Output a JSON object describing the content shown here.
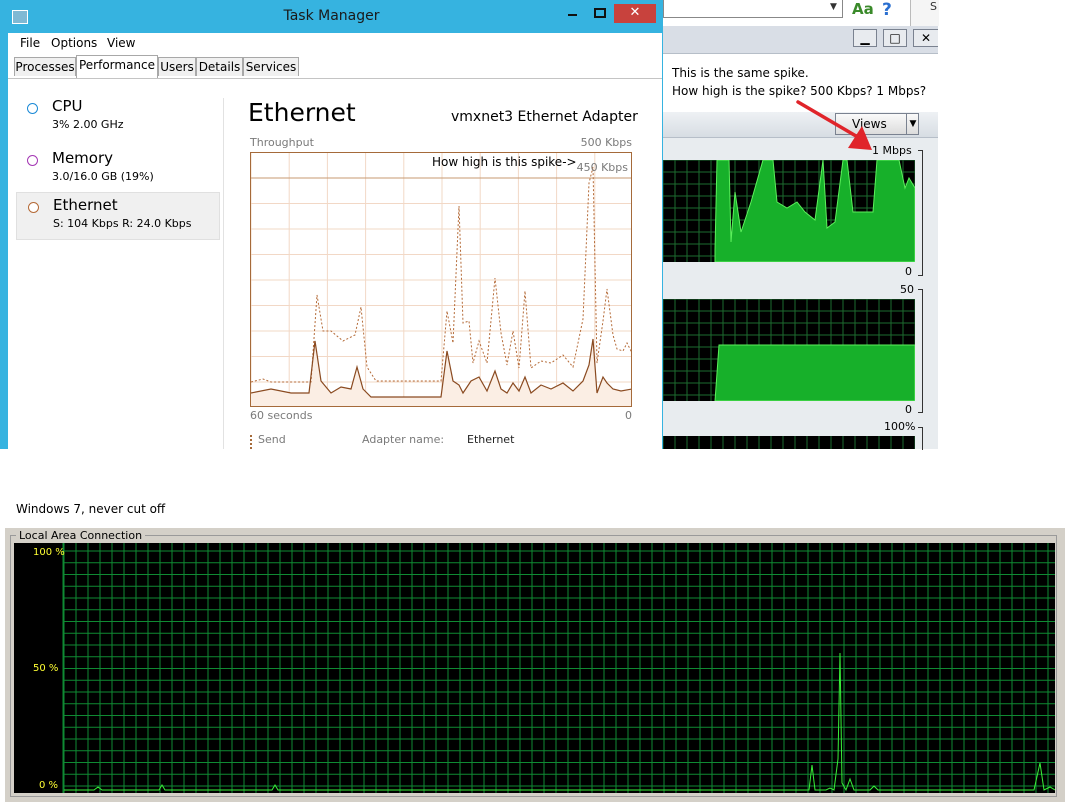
{
  "task_manager": {
    "title": "Task Manager",
    "menu": [
      "File",
      "Options",
      "View"
    ],
    "tabs": [
      "Processes",
      "Performance",
      "Users",
      "Details",
      "Services"
    ],
    "active_tab": "Performance",
    "sidebar": [
      {
        "name": "CPU",
        "detail": "3%  2.00 GHz",
        "color": "#1b8ad6",
        "selected": false
      },
      {
        "name": "Memory",
        "detail": "3.0/16.0 GB (19%)",
        "color": "#a437b4",
        "selected": false
      },
      {
        "name": "Ethernet",
        "detail": "S: 104 Kbps  R: 24.0 Kbps",
        "color": "#b46a37",
        "selected": true
      }
    ],
    "main": {
      "title": "Ethernet",
      "adapter": "vmxnet3 Ethernet Adapter",
      "throughput_label": "Throughput",
      "max_label": "500 Kbps",
      "scale_label": "450 Kbps",
      "spike_note": "How high is this spike->",
      "time_label": "60 seconds",
      "zero_label": "0",
      "send_label": "Send",
      "adapter_name_label": "Adapter name:",
      "adapter_name_value": "Ethernet"
    },
    "graph_colors": {
      "line": "#a56a3a",
      "grid": "#f2d8c6",
      "fill": "#fbeee4"
    }
  },
  "resource_monitor": {
    "note_line1": "This is the same spike.",
    "note_line2": "How high is the spike? 500 Kbps? 1 Mbps?",
    "views_label": "Views",
    "labels": {
      "g1_top": "1 Mbps",
      "g1_bottom": "0",
      "g2_top": "50",
      "g2_bottom": "0",
      "g3_top": "100%"
    },
    "graph_colors": {
      "grid": "#1d6b2f",
      "fill": "#17b02a",
      "line": "#5cf05c"
    },
    "toolbar": {
      "aa": "Aa",
      "help": "?",
      "s": "S"
    },
    "arrow_color": "#e0242a"
  },
  "win7": {
    "caption": "Windows 7, never cut off",
    "group_label": "Local Area Connection",
    "y_labels": [
      "100 %",
      "50 %",
      "0 %"
    ],
    "graph_colors": {
      "grid": "#0f8a33",
      "line": "#38f038"
    }
  }
}
